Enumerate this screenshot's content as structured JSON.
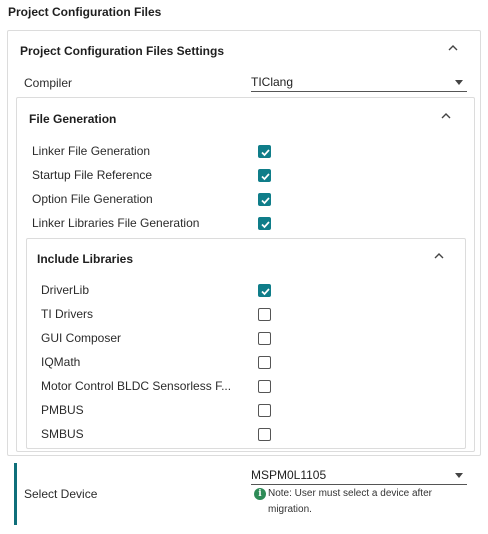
{
  "page": {
    "title": "Project Configuration Files"
  },
  "settings": {
    "header": "Project Configuration Files Settings",
    "compiler": {
      "label": "Compiler",
      "value": "TIClang"
    }
  },
  "file_generation": {
    "header": "File Generation",
    "items": [
      {
        "label": "Linker File Generation",
        "checked": true
      },
      {
        "label": "Startup File Reference",
        "checked": true
      },
      {
        "label": "Option File Generation",
        "checked": true
      },
      {
        "label": "Linker Libraries File Generation",
        "checked": true
      }
    ]
  },
  "include_libraries": {
    "header": "Include Libraries",
    "items": [
      {
        "label": "DriverLib",
        "checked": true
      },
      {
        "label": "TI Drivers",
        "checked": false
      },
      {
        "label": "GUI Composer",
        "checked": false
      },
      {
        "label": "IQMath",
        "checked": false
      },
      {
        "label": "Motor Control BLDC Sensorless F...",
        "checked": false
      },
      {
        "label": "PMBUS",
        "checked": false
      },
      {
        "label": "SMBUS",
        "checked": false
      }
    ]
  },
  "device": {
    "label": "Select Device",
    "value": "MSPM0L1105",
    "note_line1": "Note: User must select a device after",
    "note_line2": "migration."
  },
  "colors": {
    "accent": "#0f7d89",
    "accent_bar": "#0f6f7a",
    "info": "#2e8b57"
  }
}
